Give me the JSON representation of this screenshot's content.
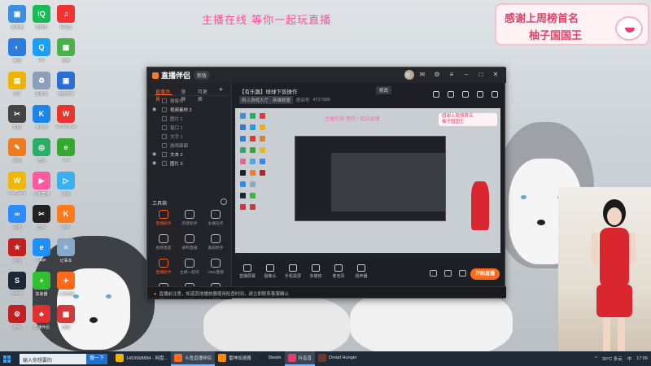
{
  "overlay": {
    "top_banner": "主播在线 等你一起玩直播",
    "thanks_line1": "感谢上周榜首名",
    "thanks_line2": "柚子国国王",
    "thanks_badge": "LIVE"
  },
  "desktop_icons": [
    {
      "label": "此电脑",
      "color": "#3a8fe0",
      "glyph": "▣"
    },
    {
      "label": "爱奇艺",
      "color": "#19b955",
      "glyph": "iQ"
    },
    {
      "label": "网易云",
      "color": "#e33",
      "glyph": "♫"
    },
    {
      "label": "傲游",
      "color": "#2d7cdc",
      "glyph": "◐"
    },
    {
      "label": "QQ",
      "color": "#1aa0f2",
      "glyph": "Q"
    },
    {
      "label": "应用",
      "color": "#4ab04a",
      "glyph": "▦"
    },
    {
      "label": "文件",
      "color": "#f0b400",
      "glyph": "▤"
    },
    {
      "label": "回收站",
      "color": "#8aa0b8",
      "glyph": "♻"
    },
    {
      "label": "电脑管家",
      "color": "#2a6fd6",
      "glyph": "▣"
    },
    {
      "label": "截图",
      "color": "#444",
      "glyph": "✂"
    },
    {
      "label": "鲁大师",
      "color": "#1b86e8",
      "glyph": "K"
    },
    {
      "label": "WPS Office",
      "color": "#e8362e",
      "glyph": "W"
    },
    {
      "label": "画图",
      "color": "#f07a20",
      "glyph": "✎"
    },
    {
      "label": "微信",
      "color": "#2aae67",
      "glyph": "◎"
    },
    {
      "label": "360",
      "color": "#36a82f",
      "glyph": "e"
    },
    {
      "label": "WeGame",
      "color": "#f2b700",
      "glyph": "W"
    },
    {
      "label": "斗鱼直播",
      "color": "#ff5aa0",
      "glyph": "▶"
    },
    {
      "label": "视频",
      "color": "#3ab0f0",
      "glyph": "▷"
    },
    {
      "label": "网盘",
      "color": "#2a8cff",
      "glyph": "∞"
    },
    {
      "label": "剪映",
      "color": "#222",
      "glyph": "✂"
    },
    {
      "label": "快手",
      "color": "#ff7a1a",
      "glyph": "K"
    },
    {
      "label": "游戏",
      "color": "#c52020",
      "glyph": "★"
    },
    {
      "label": "Edge",
      "color": "#1e90ff",
      "glyph": "e"
    },
    {
      "label": "记事本",
      "color": "#89a9c9",
      "glyph": "≡"
    },
    {
      "label": "Steam",
      "color": "#1b2838",
      "glyph": "S"
    },
    {
      "label": "加速器",
      "color": "#30c030",
      "glyph": "+"
    },
    {
      "label": "斗鱼直播",
      "color": "#ff6a1a",
      "glyph": "✦"
    },
    {
      "label": "游戏",
      "color": "#c02020",
      "glyph": "⚙"
    },
    {
      "label": "直播伴侣",
      "color": "#e03030",
      "glyph": "♣"
    },
    {
      "label": "直播",
      "color": "#d03a3a",
      "glyph": "▦"
    }
  ],
  "app": {
    "title": "直播伴侣",
    "version": "新版",
    "scene_tabs": [
      "直播场景",
      "竖屏",
      "可更换"
    ],
    "layers": [
      {
        "name": "摄像头",
        "on": false
      },
      {
        "name": "视频素材 2",
        "on": true
      },
      {
        "name": "图片 1",
        "on": false
      },
      {
        "name": "窗口 1",
        "on": false
      },
      {
        "name": "文字 1",
        "on": false
      },
      {
        "name": "游戏画面",
        "on": false
      },
      {
        "name": "文本 2",
        "on": true
      },
      {
        "name": "图片 3",
        "on": true
      }
    ],
    "tools_title": "工具箱",
    "tools": [
      {
        "label": "直播助手",
        "hot": true
      },
      {
        "label": "房管助手",
        "hot": false
      },
      {
        "label": "主播任务",
        "hot": false
      },
      {
        "label": "视频连麦",
        "hot": false
      },
      {
        "label": "录制直播",
        "hot": false
      },
      {
        "label": "美颜助手",
        "hot": false
      },
      {
        "label": "直播助手",
        "hot": true
      },
      {
        "label": "主播一起玩",
        "hot": false
      },
      {
        "label": "OBS直播",
        "hot": false
      },
      {
        "label": "更多",
        "hot": false
      },
      {
        "label": "日历",
        "hot": false
      },
      {
        "label": "设置",
        "hot": false
      }
    ],
    "notice": "直播前注意，知道其他播放器使用检查时间，请立即联系客服确认",
    "live_title": "【有乐趣】球球下饭操作",
    "edit_label": "修改",
    "live_tag": "网上游戏大厅 · 英雄联盟",
    "live_id_label": "房间号",
    "live_id": "4717985",
    "preview_banner": "主播在线 等你一起玩直播",
    "preview_card": "感谢上周榜首名\n柚子国国王",
    "controls": [
      {
        "label": "直播屏幕"
      },
      {
        "label": "摄像头"
      },
      {
        "label": "手机投屏"
      },
      {
        "label": "多媒体"
      },
      {
        "label": "麦克风"
      },
      {
        "label": "扬声器"
      }
    ],
    "go_live": "开始直播"
  },
  "taskbar": {
    "search_placeholder": "输入你想要的",
    "search_button": "搜一下",
    "tasks": [
      {
        "label": "1453998884 - 网盘...",
        "color": "#f0b400",
        "active": false
      },
      {
        "label": "斗鱼直播伴侣",
        "color": "#ff6a1a",
        "active": true
      },
      {
        "label": "雷神加速器",
        "color": "#ff8a00",
        "active": false
      },
      {
        "label": "Steam",
        "color": "#1b2838",
        "active": false
      },
      {
        "label": "抖音直",
        "color": "#e0426a",
        "active": true
      },
      {
        "label": "Dread Hunger",
        "color": "#6b3a2a",
        "active": false
      }
    ],
    "weather": "30°C 多云",
    "time": "17:06",
    "lang": "中"
  }
}
